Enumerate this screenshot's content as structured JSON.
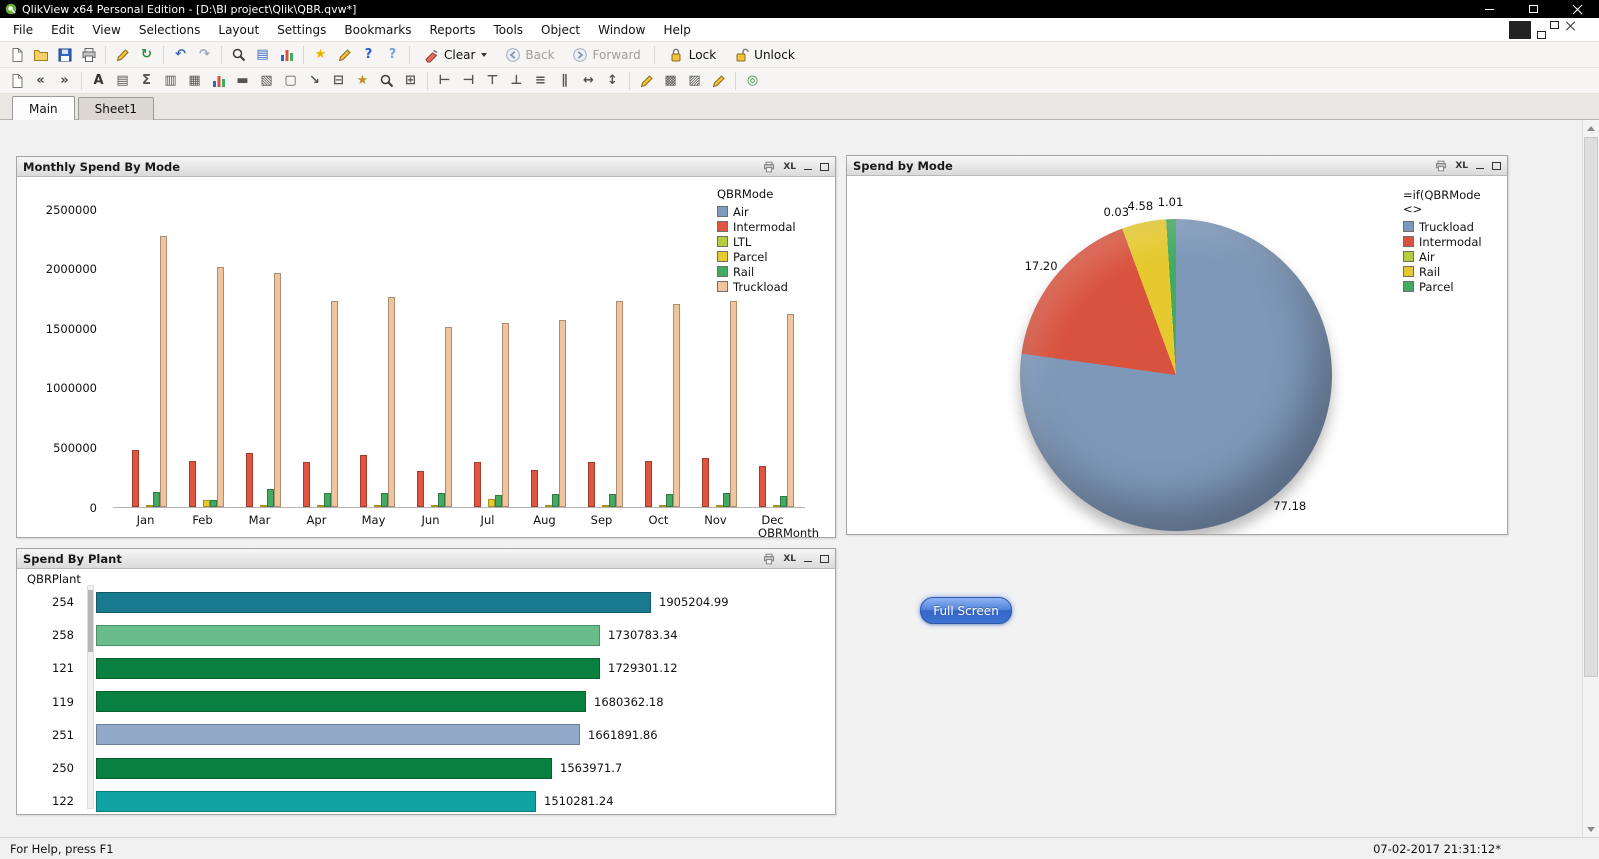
{
  "window": {
    "title": "QlikView x64 Personal Edition - [D:\\BI project\\Qlik\\QBR.qvw*]"
  },
  "menu": {
    "items": [
      "File",
      "Edit",
      "View",
      "Selections",
      "Layout",
      "Settings",
      "Bookmarks",
      "Reports",
      "Tools",
      "Object",
      "Window",
      "Help"
    ]
  },
  "toolbar_main": {
    "icons": [
      "new-document",
      "open-file",
      "save",
      "print",
      "|",
      "edit-script",
      "reload",
      "|",
      "undo",
      "redo",
      "|",
      "find",
      "current-selections",
      "quick-chart-wizard",
      "|",
      "bookmark-star",
      "notes",
      "help",
      "context-help"
    ],
    "clear_label": "Clear",
    "back_label": "Back",
    "forward_label": "Forward",
    "lock_label": "Lock",
    "unlock_label": "Unlock"
  },
  "toolbar_design": {
    "icons": [
      "new-sheet",
      "promote-sheet",
      "demote-sheet",
      "|",
      "text-object",
      "list-box",
      "statistics-box",
      "multi-box",
      "table-box",
      "chart",
      "input-box",
      "current-selections-box",
      "button",
      "line-arrow",
      "slider",
      "bookmark-object",
      "search-object",
      "container",
      "|",
      "align-left",
      "align-right",
      "align-top",
      "align-bottom",
      "center-horizontal",
      "center-vertical",
      "space-horizontal",
      "space-vertical",
      "|",
      "format-painter",
      "sheet-properties",
      "document-properties",
      "edit-module",
      "|",
      "webview"
    ]
  },
  "tabs": [
    {
      "label": "Main",
      "active": true
    },
    {
      "label": "Sheet1",
      "active": false
    }
  ],
  "caption_icons": {
    "excel": "XL"
  },
  "chart_data": [
    {
      "type": "bar",
      "title": "Monthly Spend By Mode",
      "xlabel": "QBRMonth",
      "legend_title": "QBRMode",
      "categories": [
        "Jan",
        "Feb",
        "Mar",
        "Apr",
        "May",
        "Jun",
        "Jul",
        "Aug",
        "Sep",
        "Oct",
        "Nov",
        "Dec"
      ],
      "series": [
        {
          "name": "Air",
          "color": "#7f9bbd",
          "values": [
            3000,
            2000,
            2000,
            2000,
            2000,
            2000,
            2000,
            2000,
            2000,
            2000,
            2000,
            2000
          ]
        },
        {
          "name": "Intermodal",
          "color": "#e1543f",
          "values": [
            480000,
            390000,
            450000,
            380000,
            440000,
            300000,
            380000,
            310000,
            380000,
            390000,
            410000,
            340000
          ]
        },
        {
          "name": "LTL",
          "color": "#b8cc3f",
          "values": [
            4000,
            3000,
            3000,
            3000,
            3000,
            3000,
            3000,
            3000,
            3000,
            3000,
            3000,
            3000
          ]
        },
        {
          "name": "Parcel",
          "color": "#e9c930",
          "values": [
            20000,
            60000,
            15000,
            15000,
            15000,
            15000,
            70000,
            15000,
            15000,
            15000,
            15000,
            15000
          ]
        },
        {
          "name": "Rail",
          "color": "#43ab61",
          "values": [
            130000,
            60000,
            150000,
            120000,
            120000,
            115000,
            100000,
            110000,
            105000,
            110000,
            120000,
            95000
          ]
        },
        {
          "name": "Truckload",
          "color": "#efc49e",
          "values": [
            2270000,
            2010000,
            1960000,
            1730000,
            1760000,
            1510000,
            1540000,
            1570000,
            1730000,
            1700000,
            1730000,
            1620000
          ]
        }
      ],
      "ylim": [
        0,
        2500000
      ],
      "yticks": [
        0,
        500000,
        1000000,
        1500000,
        2000000,
        2500000
      ],
      "grid": false,
      "legend_position": "right-top"
    },
    {
      "type": "pie",
      "title": "Spend by Mode",
      "legend_title": "=if(QBRMode <>",
      "slices": [
        {
          "name": "Truckload",
          "value": 77.18,
          "color": "#7e98ba"
        },
        {
          "name": "Intermodal",
          "value": 17.2,
          "color": "#d8523e"
        },
        {
          "name": "Air",
          "value": 0.03,
          "color": "#b8cc3f"
        },
        {
          "name": "Rail",
          "value": 4.58,
          "color": "#e5c92f"
        },
        {
          "name": "Parcel",
          "value": 1.01,
          "color": "#43ab61"
        }
      ],
      "legend_position": "right-top"
    },
    {
      "type": "bar",
      "orientation": "horizontal",
      "title": "Spend By Plant",
      "axis_label": "QBRPlant",
      "categories": [
        "254",
        "258",
        "121",
        "119",
        "251",
        "250",
        "122"
      ],
      "values": [
        1905204.99,
        1730783.34,
        1729301.12,
        1680362.18,
        1661891.86,
        1563971.7,
        1510281.24
      ],
      "value_labels": [
        "1905204.99",
        "1730783.34",
        "1729301.12",
        "1680362.18",
        "1661891.86",
        "1563971.7",
        "1510281.24"
      ],
      "colors": [
        "#19798e",
        "#68bd8b",
        "#0a8040",
        "#0a8040",
        "#93a9c9",
        "#0a8040",
        "#0fa3a3"
      ]
    }
  ],
  "full_screen_button": {
    "label": "Full Screen"
  },
  "status_bar": {
    "left": "For Help, press F1",
    "right": "07-02-2017 21:31:12*"
  }
}
